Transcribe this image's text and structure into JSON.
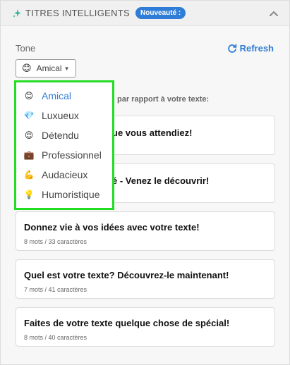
{
  "header": {
    "title": "TITRES INTELLIGENTS",
    "badge": "Nouveauté :",
    "accent": "#2f7dd6"
  },
  "tone": {
    "label": "Tone",
    "selected": "Amical",
    "selected_icon": "😊",
    "refresh_label": "Refresh"
  },
  "dropdown": {
    "border_color": "#22dd22",
    "options": [
      {
        "icon": "😊",
        "label": "Amical",
        "active": true
      },
      {
        "icon": "💎",
        "label": "Luxueux"
      },
      {
        "icon": "😌",
        "label": "Détendu"
      },
      {
        "icon": "💼",
        "label": "Professionnel"
      },
      {
        "icon": "💪",
        "label": "Audacieux"
      },
      {
        "icon": "💡",
        "label": "Humoristique"
      }
    ]
  },
  "subtitle": "par rapport à votre texte:",
  "cards": [
    {
      "title": "ue vous attendiez!"
    },
    {
      "title": "é - Venez le découvrir!"
    },
    {
      "title": "Donnez vie à vos idées avec votre texte!",
      "meta": "8 mots / 33 caractères"
    },
    {
      "title": "Quel est votre texte? Découvrez-le maintenant!",
      "meta": "7 mots / 41 caractères"
    },
    {
      "title": "Faites de votre texte quelque chose de spécial!",
      "meta": "8 mots / 40 caractères"
    }
  ]
}
